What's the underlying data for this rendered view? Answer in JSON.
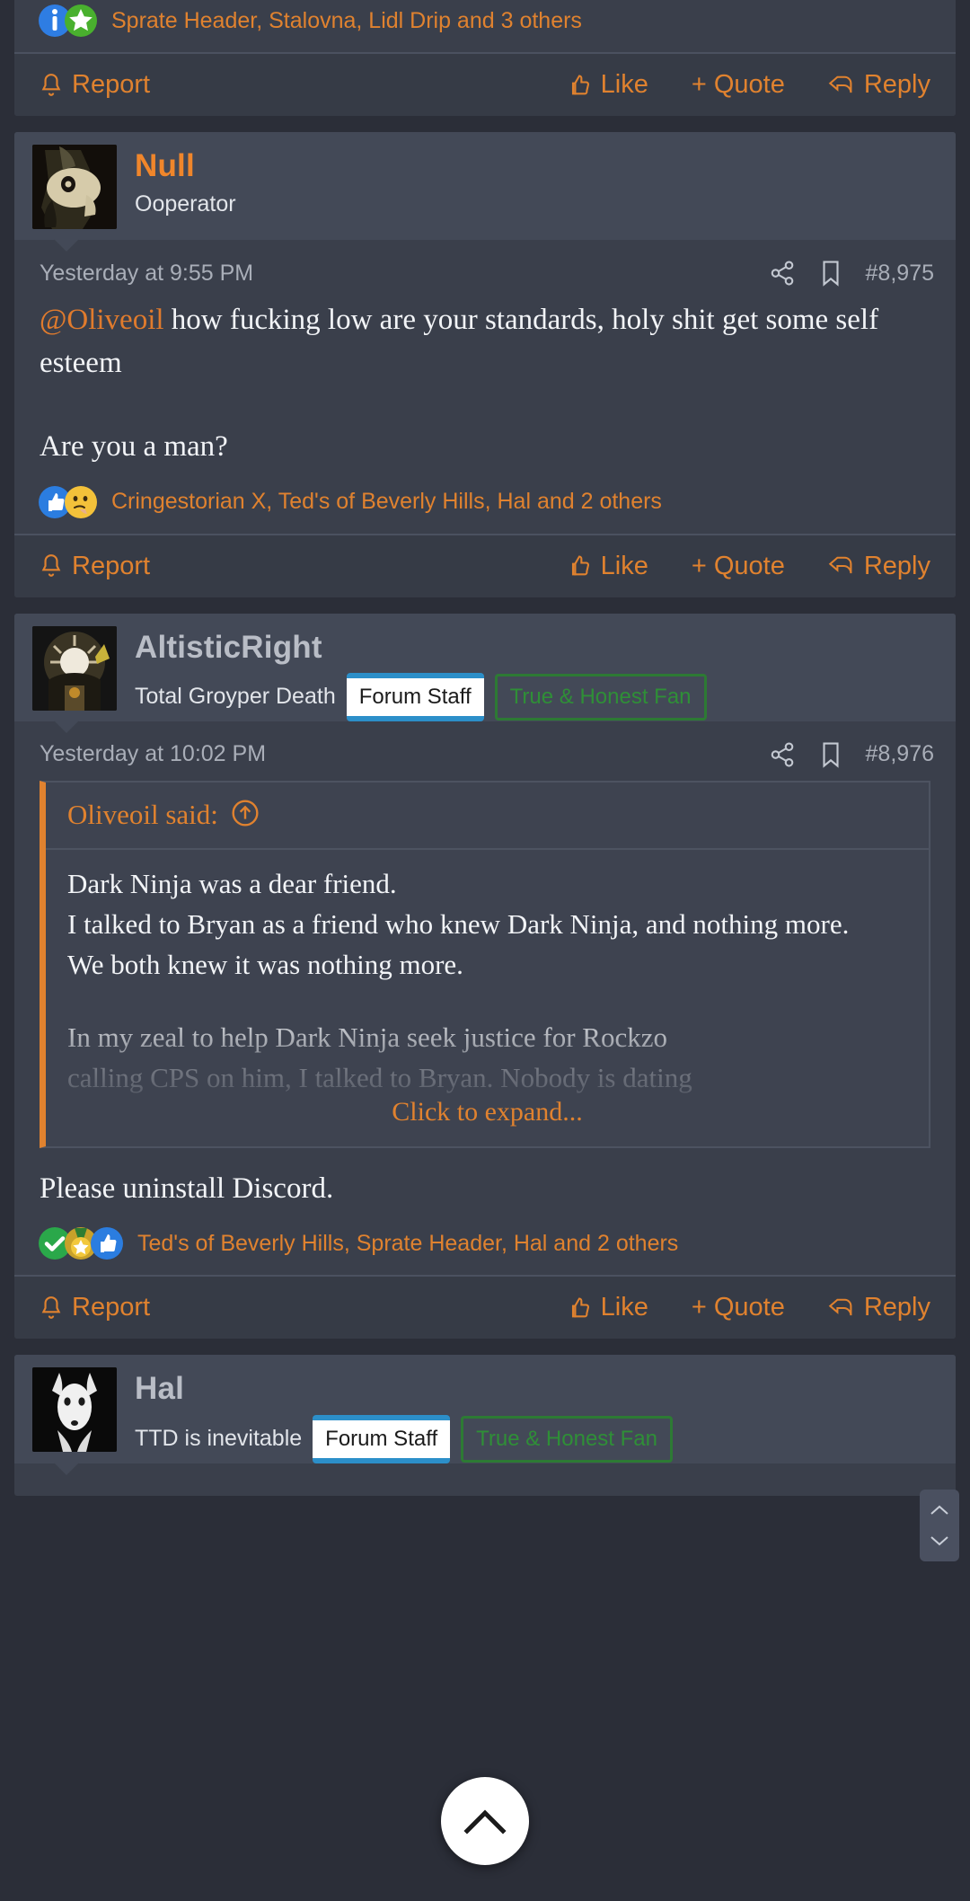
{
  "theme": {
    "page_bg": "#2b2e38",
    "post_bg": "#3a3f4b",
    "header_bg": "#434957",
    "accent": "#e0822f",
    "username_orange": "#f0862b",
    "username_grey": "#b9bdc6",
    "badge_blue": "#2c8fc9",
    "badge_green": "#2d7a34",
    "muted_text": "#a9aeb8"
  },
  "actions": {
    "report": "Report",
    "like": "Like",
    "quote": "+ Quote",
    "reply": "Reply"
  },
  "posts": [
    {
      "id": "post-partial-top",
      "reactions_text": "Sprate Header, Stalovna, Lidl Drip and 3 others",
      "reaction_emoji": [
        "information-emoji",
        "star-emoji"
      ]
    },
    {
      "id": "post-null",
      "username": "Null",
      "user_title": "Ooperator",
      "avatar": "null-avatar",
      "timestamp": "Yesterday at 9:55 PM",
      "post_number": "#8,975",
      "body": {
        "mention": "@Oliveoil",
        "line1_rest": " how fucking low are your standards, holy shit get some self esteem",
        "line2": "Are you a man?"
      },
      "reactions_text": "Cringestorian X, Ted's of Beverly Hills, Hal and 2 others",
      "reaction_emoji": [
        "thumbsup-emoji",
        "thinking-emoji"
      ]
    },
    {
      "id": "post-altisticright",
      "username": "AltisticRight",
      "user_title": "Total Groyper Death",
      "avatar": "altisticright-avatar",
      "badges": [
        "Forum Staff",
        "True & Honest Fan"
      ],
      "timestamp": "Yesterday at 10:02 PM",
      "post_number": "#8,976",
      "quote": {
        "author_label": "Oliveoil said:",
        "jump_icon": "arrow-up-circle-icon",
        "lines": [
          "Dark Ninja was a dear friend.",
          "I talked to Bryan as a friend who knew Dark Ninja, and nothing more.",
          "We both knew it was nothing more."
        ],
        "faded_lines": [
          "In my zeal to help Dark Ninja seek justice for Rockzo",
          "calling CPS on him, I talked to Bryan. Nobody is dating"
        ],
        "expand_label": "Click to expand..."
      },
      "body": {
        "line1": "Please uninstall Discord."
      },
      "reactions_text": "Ted's of Beverly Hills, Sprate Header, Hal and 2 others",
      "reaction_emoji": [
        "check-emoji",
        "medal-emoji",
        "thumbsup-emoji"
      ]
    },
    {
      "id": "post-hal",
      "username": "Hal",
      "user_title": "TTD is inevitable",
      "avatar": "hal-avatar",
      "badges": [
        "Forum Staff",
        "True & Honest Fan"
      ]
    }
  ],
  "floating": {
    "scroll_to_top_icon": "chevron-up-icon"
  },
  "scroll_widget": {
    "up_icon": "chevron-up-small-icon",
    "down_icon": "chevron-down-small-icon"
  }
}
